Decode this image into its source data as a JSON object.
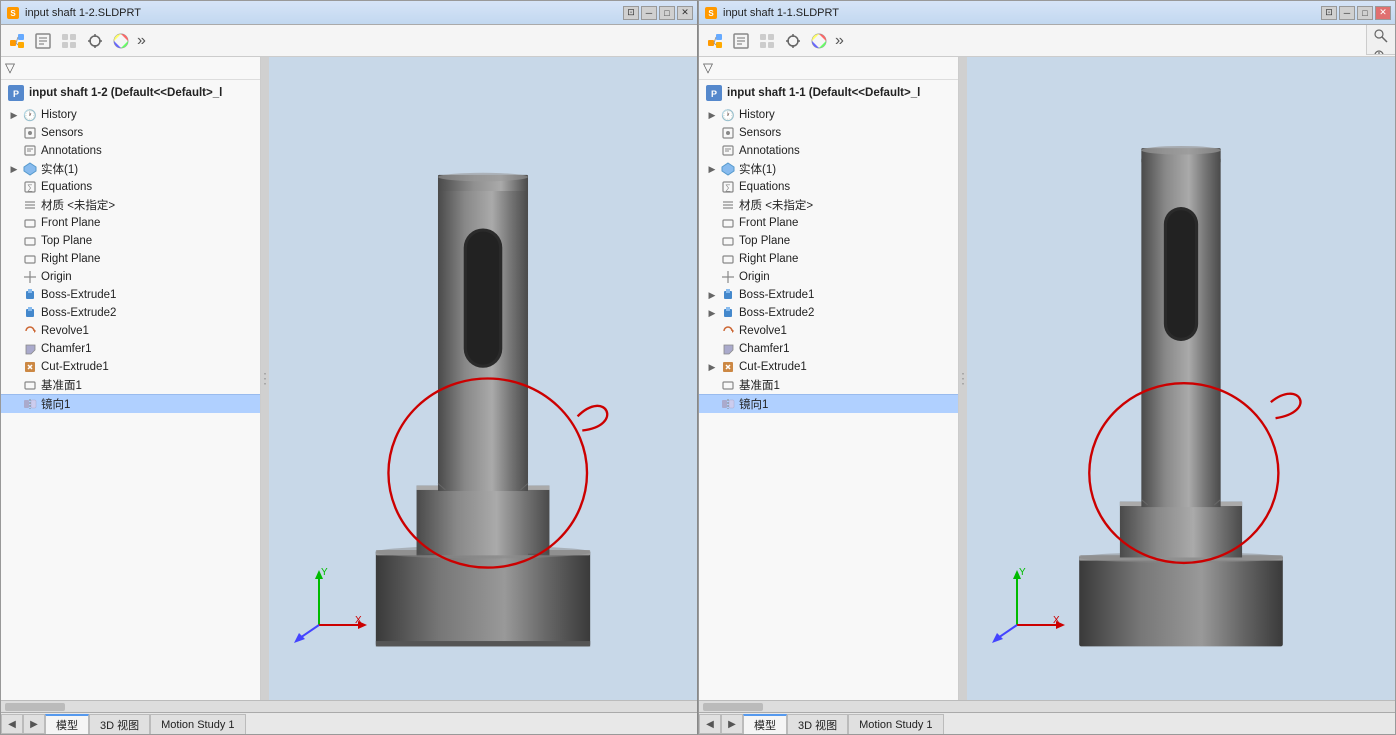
{
  "left_window": {
    "title": "input shaft 1-2.SLDPRT",
    "root_label": "input shaft 1-2  (Default<<Default>_l",
    "toolbar_icons": [
      "feature-tree-icon",
      "property-icon",
      "config-icon",
      "crosshair-icon",
      "color-icon"
    ],
    "tree_items": [
      {
        "id": "history",
        "label": "History",
        "icon": "history",
        "arrow": true,
        "indent": 1
      },
      {
        "id": "sensors",
        "label": "Sensors",
        "icon": "sensors",
        "arrow": false,
        "indent": 1
      },
      {
        "id": "annotations",
        "label": "Annotations",
        "icon": "annotations",
        "arrow": false,
        "indent": 1
      },
      {
        "id": "solid1",
        "label": "实体(1)",
        "icon": "solid",
        "arrow": true,
        "indent": 1
      },
      {
        "id": "equations",
        "label": "Equations",
        "icon": "equations",
        "arrow": false,
        "indent": 1
      },
      {
        "id": "material",
        "label": "材质 <未指定>",
        "icon": "material",
        "arrow": false,
        "indent": 1
      },
      {
        "id": "frontplane",
        "label": "Front Plane",
        "icon": "plane",
        "arrow": false,
        "indent": 1
      },
      {
        "id": "topplane",
        "label": "Top Plane",
        "icon": "plane",
        "arrow": false,
        "indent": 1
      },
      {
        "id": "rightplane",
        "label": "Right Plane",
        "icon": "plane",
        "arrow": false,
        "indent": 1
      },
      {
        "id": "origin",
        "label": "Origin",
        "icon": "origin",
        "arrow": false,
        "indent": 1
      },
      {
        "id": "bossextrude1",
        "label": "Boss-Extrude1",
        "icon": "boss",
        "arrow": false,
        "indent": 1
      },
      {
        "id": "bossextrude2",
        "label": "Boss-Extrude2",
        "icon": "boss",
        "arrow": false,
        "indent": 1
      },
      {
        "id": "revolve1",
        "label": "Revolve1",
        "icon": "revolve",
        "arrow": false,
        "indent": 1
      },
      {
        "id": "chamfer1",
        "label": "Chamfer1",
        "icon": "chamfer",
        "arrow": false,
        "indent": 1
      },
      {
        "id": "cutextrude1",
        "label": "Cut-Extrude1",
        "icon": "cut",
        "arrow": false,
        "indent": 1
      },
      {
        "id": "baseplane1",
        "label": "基准面1",
        "icon": "plane",
        "arrow": false,
        "indent": 1
      },
      {
        "id": "mirror1",
        "label": "镜向1",
        "icon": "mirror",
        "arrow": false,
        "indent": 1,
        "selected": true
      }
    ],
    "bottom_tabs": [
      "模型",
      "3D 视图",
      "Motion Study 1"
    ],
    "active_tab": "模型"
  },
  "right_window": {
    "title": "input shaft 1-1.SLDPRT",
    "root_label": "input shaft 1-1  (Default<<Default>_l",
    "toolbar_icons": [
      "feature-tree-icon",
      "property-icon",
      "config-icon",
      "crosshair-icon",
      "color-icon"
    ],
    "extra_toolbar_icons": [
      "zoom-icon",
      "zoom2-icon",
      "rotate-icon",
      "pan-icon",
      "fit-icon",
      "section-icon",
      "appearance-icon",
      "hide-icon",
      "arrow-icon",
      "display-icon",
      "realview-icon",
      "photoview-icon",
      "monitor-icon",
      "separator",
      "download-icon"
    ],
    "tree_items": [
      {
        "id": "history",
        "label": "History",
        "icon": "history",
        "arrow": true,
        "indent": 1
      },
      {
        "id": "sensors",
        "label": "Sensors",
        "icon": "sensors",
        "arrow": false,
        "indent": 1
      },
      {
        "id": "annotations",
        "label": "Annotations",
        "icon": "annotations",
        "arrow": false,
        "indent": 1
      },
      {
        "id": "solid1",
        "label": "实体(1)",
        "icon": "solid",
        "arrow": true,
        "indent": 1
      },
      {
        "id": "equations",
        "label": "Equations",
        "icon": "equations",
        "arrow": false,
        "indent": 1
      },
      {
        "id": "material",
        "label": "材质 <未指定>",
        "icon": "material",
        "arrow": false,
        "indent": 1
      },
      {
        "id": "frontplane",
        "label": "Front Plane",
        "icon": "plane",
        "arrow": false,
        "indent": 1
      },
      {
        "id": "topplane",
        "label": "Top Plane",
        "icon": "plane",
        "arrow": false,
        "indent": 1
      },
      {
        "id": "rightplane",
        "label": "Right Plane",
        "icon": "plane",
        "arrow": false,
        "indent": 1
      },
      {
        "id": "origin",
        "label": "Origin",
        "icon": "origin",
        "arrow": false,
        "indent": 1
      },
      {
        "id": "bossextrude1",
        "label": "Boss-Extrude1",
        "icon": "boss",
        "arrow": true,
        "indent": 1
      },
      {
        "id": "bossextrude2",
        "label": "Boss-Extrude2",
        "icon": "boss",
        "arrow": true,
        "indent": 1
      },
      {
        "id": "revolve1",
        "label": "Revolve1",
        "icon": "revolve",
        "arrow": false,
        "indent": 1
      },
      {
        "id": "chamfer1",
        "label": "Chamfer1",
        "icon": "chamfer",
        "arrow": false,
        "indent": 1
      },
      {
        "id": "cutextrude1",
        "label": "Cut-Extrude1",
        "icon": "cut",
        "arrow": true,
        "indent": 1
      },
      {
        "id": "baseplane1",
        "label": "基准面1",
        "icon": "plane",
        "arrow": false,
        "indent": 1
      },
      {
        "id": "mirror1",
        "label": "镜向1",
        "icon": "mirror",
        "arrow": false,
        "indent": 1,
        "selected": true
      }
    ],
    "bottom_tabs": [
      "模型",
      "3D 视图",
      "Motion Study 1"
    ],
    "active_tab": "模型"
  },
  "icons": {
    "history": "🕐",
    "sensors": "📡",
    "annotations": "📝",
    "solid": "🔷",
    "equations": "∑",
    "material": "≡",
    "plane": "⬜",
    "origin": "⊕",
    "boss": "🔵",
    "revolve": "🔄",
    "chamfer": "◈",
    "cut": "🟧",
    "mirror": "⬡"
  }
}
